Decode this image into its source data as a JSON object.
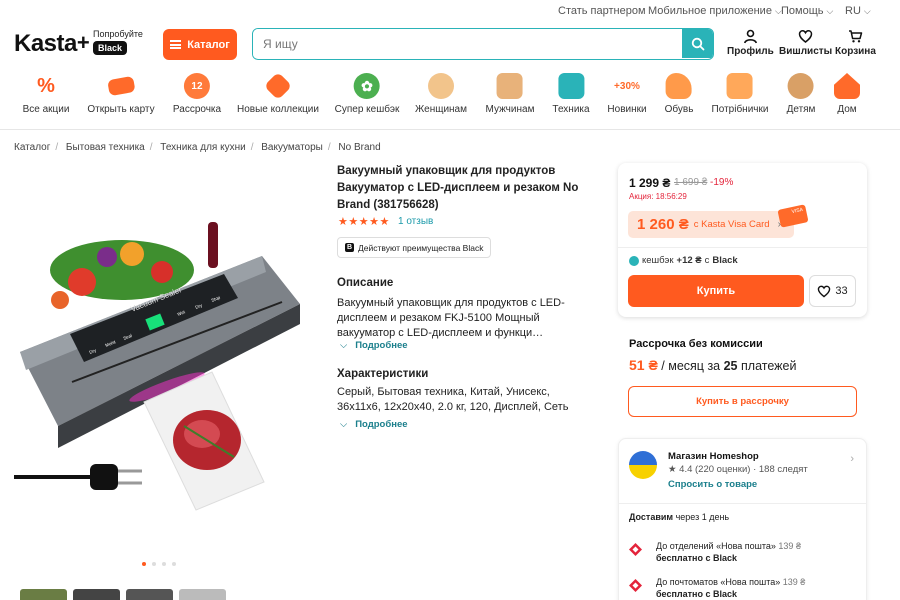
{
  "topbar": {
    "partner": "Стать партнером",
    "mobile_app": "Мобильное приложение",
    "help": "Помощь",
    "lang": "RU"
  },
  "header": {
    "logo": "Kasta",
    "logo_plus": "+",
    "try_text": "Попробуйте",
    "black_badge": "Black",
    "catalog_button": "Каталог",
    "search_placeholder": "Я ищу",
    "profile": "Профиль",
    "wishlist": "Вишлисты",
    "cart": "Корзина"
  },
  "categories": [
    {
      "label": "Все акции",
      "icon": "percent-icon",
      "color": "#ff5a1f"
    },
    {
      "label": "Открыть карту",
      "icon": "card-icon",
      "color": "#ff6a2a"
    },
    {
      "label": "Рассрочка",
      "icon": "installment-icon",
      "color": "#ff7a3a"
    },
    {
      "label": "Новые коллекции",
      "icon": "tag-icon",
      "color": "#ff6a2a"
    },
    {
      "label": "Супер кешбэк",
      "icon": "cashback-icon",
      "color": "#4caf50"
    },
    {
      "label": "Женщинам",
      "icon": "women-icon",
      "color": "#f2b36b"
    },
    {
      "label": "Мужчинам",
      "icon": "men-icon",
      "color": "#e8a25a"
    },
    {
      "label": "Техника",
      "icon": "tech-icon",
      "color": "#2ab3b8"
    },
    {
      "label": "Новинки",
      "icon": "new-icon",
      "color": "#ff8a3a"
    },
    {
      "label": "Обувь",
      "icon": "shoe-icon",
      "color": "#ff9a4a"
    },
    {
      "label": "Потрібнички",
      "icon": "box-icon",
      "color": "#ff9a4a"
    },
    {
      "label": "Детям",
      "icon": "bear-icon",
      "color": "#d9a066"
    },
    {
      "label": "Дом",
      "icon": "home-icon",
      "color": "#ff6a2a"
    }
  ],
  "breadcrumb": [
    "Каталог",
    "Бытовая техника",
    "Техника для кухни",
    "Вакууматоры",
    "No Brand"
  ],
  "product": {
    "title": "Вакуумный упаковщик для продуктов Вакууматор с LED-дисплеем и резаком No Brand (381756628)",
    "stars": "★★★★★",
    "reviews": "1 отзыв",
    "black_advantage": "Действуют преимущества Black",
    "desc_heading": "Описание",
    "desc_text": "Вакуумный упаковщик для продуктов с LED-дисплеем и резаком FKJ-5100 Мощный вакууматор с LED-дисплеем и функци…",
    "more": "Подробнее",
    "chars_heading": "Характеристики",
    "chars_text": "Серый, Бытовая техника, Китай, Унисекс, 36x11x6, 12x20x40, 2.0 кг, 120, Дисплей, Сеть",
    "more2": "Подробнее",
    "image_label": "Vacuum Sealer",
    "image_display": "88",
    "image_buttons": [
      "Dry",
      "Moist",
      "Seal",
      "Wet",
      "Dry",
      "Stop"
    ]
  },
  "price_card": {
    "price": "1 299 ₴",
    "old_price": "1 699 ₴",
    "discount": "-19%",
    "promo": "Акция: 18:56:29",
    "visa_price": "1 260 ₴",
    "visa_label": "с Kasta Visa Card",
    "visa_card_text": "VISA",
    "cashback_pre": "кешбэк",
    "cashback_amount": "+12 ₴",
    "cashback_post": "с",
    "cashback_black": "Black",
    "buy_button": "Купить",
    "fav_count": "33"
  },
  "installment": {
    "heading": "Рассрочка без комиссии",
    "amount": "51 ₴",
    "per": "/ месяц за",
    "count": "25",
    "payments": "платежей",
    "button": "Купить в рассрочку"
  },
  "shop": {
    "name": "Магазин Homeshop",
    "rating": "★ 4.4 (220 оценки)",
    "followers": "· 188 следят",
    "ask": "Спросить о товаре",
    "delivery_label": "Доставим",
    "delivery_time": "через 1 день",
    "rows": [
      {
        "text": "До отделений «Нова пошта»",
        "price": "139 ₴",
        "free": "бесплатно с Black"
      },
      {
        "text": "До почтоматов «Нова пошта»",
        "price": "139 ₴",
        "free": "бесплатно с Black"
      }
    ]
  },
  "colors": {
    "accent": "#ff5a1f",
    "teal": "#2ab3b8",
    "sale_red": "#e4243b"
  }
}
